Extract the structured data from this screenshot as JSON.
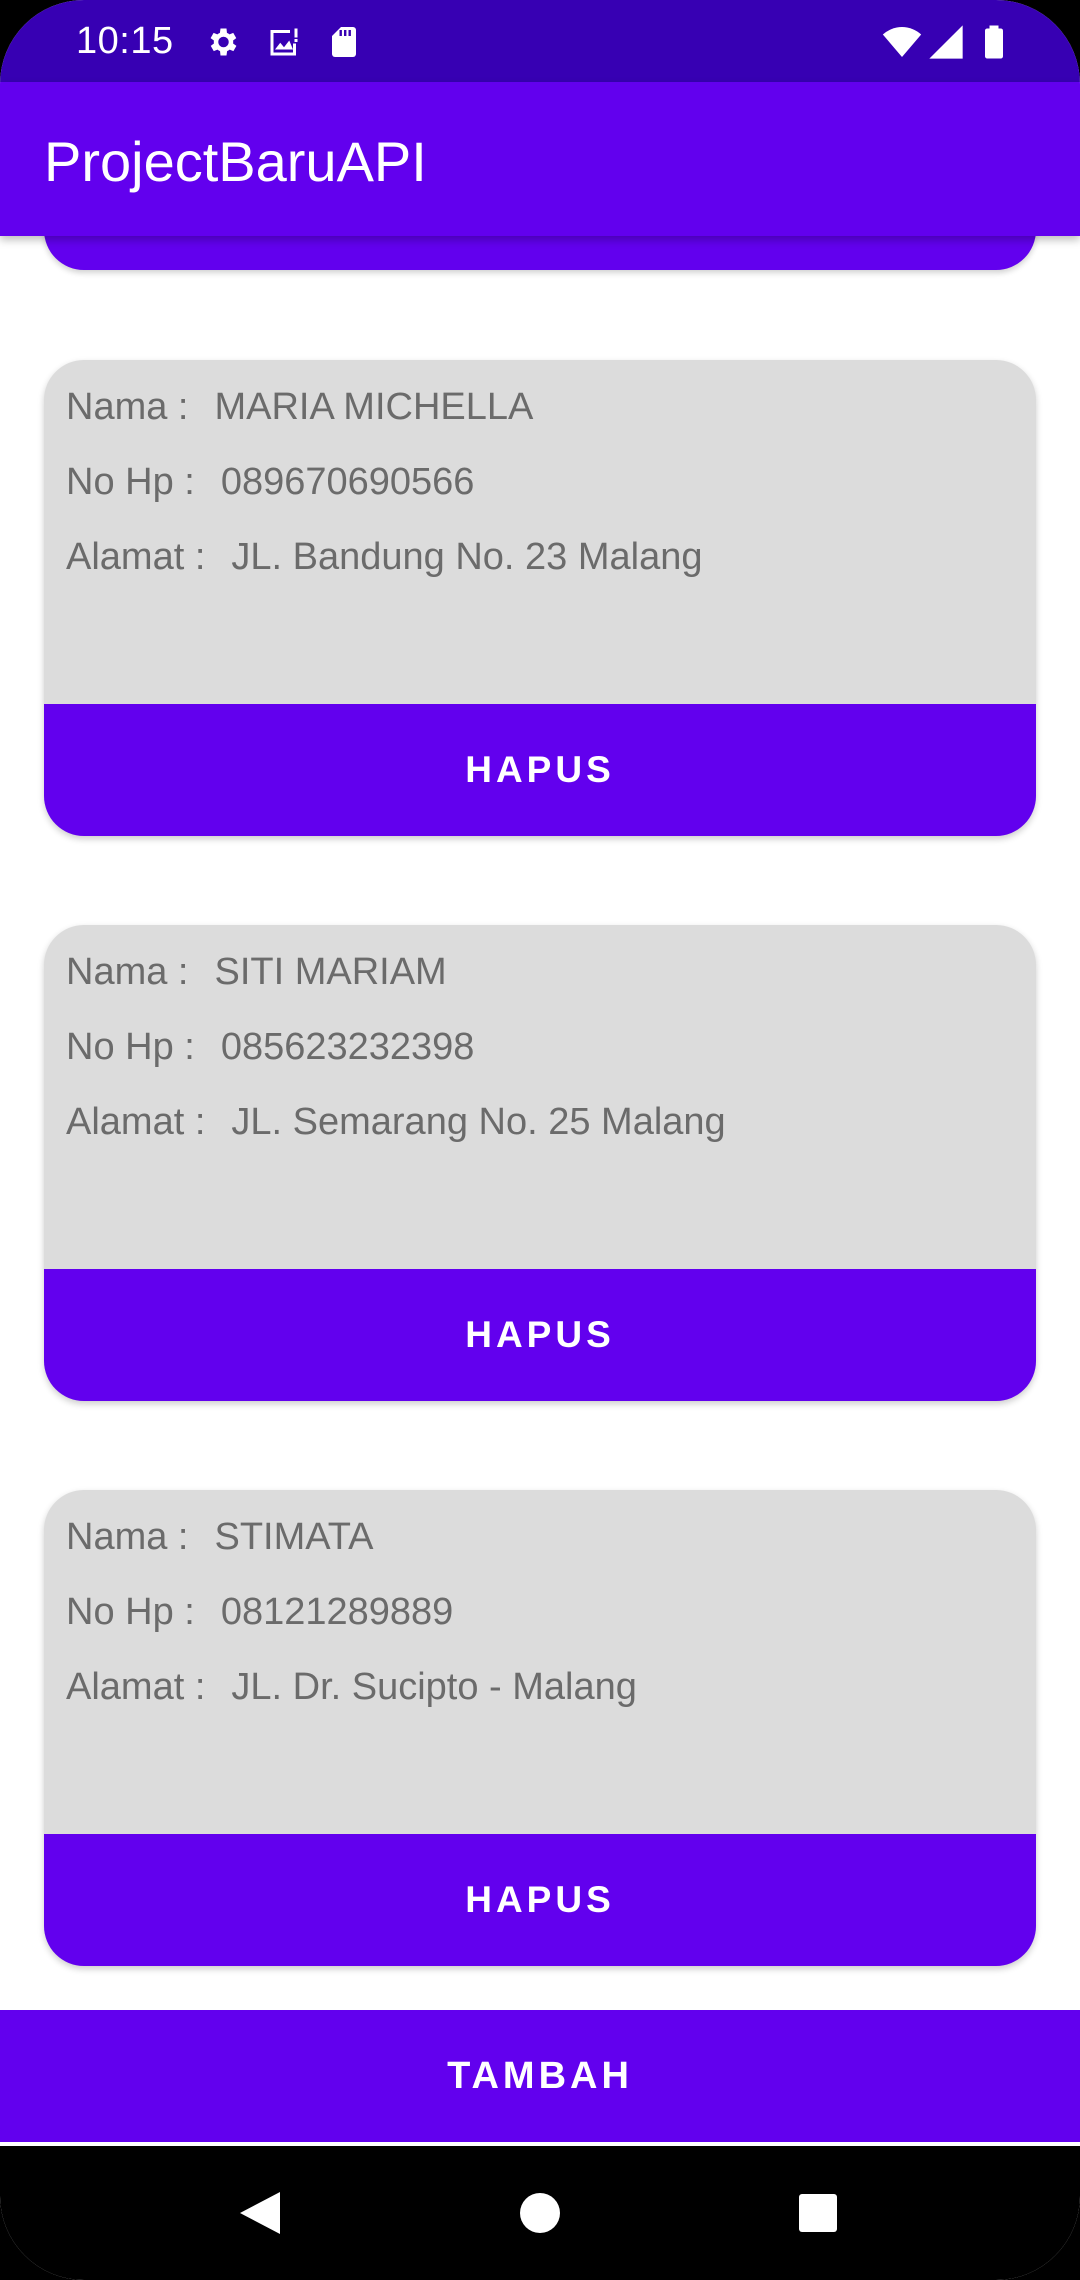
{
  "status_bar": {
    "time": "10:15",
    "icons_left": [
      "settings-icon",
      "image-notification-icon",
      "sd-card-icon"
    ],
    "icons_right": [
      "wifi-icon",
      "cell-signal-icon",
      "battery-icon"
    ]
  },
  "app_bar": {
    "title": "ProjectBaruAPI"
  },
  "labels": {
    "nama": "Nama :",
    "no_hp": "No Hp :",
    "alamat": "Alamat :"
  },
  "contacts": [
    {
      "nama": "MARIA MICHELLA",
      "no_hp": "089670690566",
      "alamat": "JL. Bandung No. 23 Malang",
      "button": "HAPUS"
    },
    {
      "nama": "SITI MARIAM",
      "no_hp": "085623232398",
      "alamat": "JL. Semarang No. 25 Malang",
      "button": "HAPUS"
    },
    {
      "nama": "STIMATA",
      "no_hp": "08121289889",
      "alamat": "JL. Dr. Sucipto - Malang",
      "button": "HAPUS"
    }
  ],
  "add_button": "TAMBAH",
  "navigation": [
    "back-icon",
    "home-icon",
    "recents-icon"
  ],
  "colors": {
    "primary": "#6200ee",
    "primary_dark": "#3700b3",
    "card_background": "#dcdcdc",
    "text_secondary": "#6b6b6b"
  }
}
